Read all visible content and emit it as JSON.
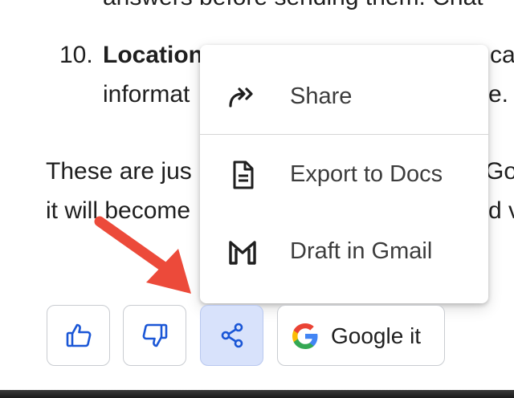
{
  "document": {
    "cut_line": "answers before sending them. Chat",
    "list_number": "10.",
    "list_heading": "Location",
    "list_heading_tail": "ca",
    "list_line2": "informat",
    "list_line2_tail": "e.",
    "para_line1": "These are jus",
    "para_line1_tail": "Go",
    "para_line2": "it will become",
    "para_line2_tail": "d v"
  },
  "share_menu": {
    "items": [
      {
        "label": "Share",
        "icon": "share-forward-icon"
      },
      {
        "label": "Export to Docs",
        "icon": "docs-icon"
      },
      {
        "label": "Draft in Gmail",
        "icon": "gmail-icon"
      }
    ]
  },
  "actions": {
    "like_icon": "thumbs-up-icon",
    "dislike_icon": "thumbs-down-icon",
    "share_icon": "share-icon",
    "google_label": "Google it",
    "google_icon": "google-g-icon"
  },
  "colors": {
    "accent_blue": "#1a56d6",
    "share_active_bg": "#d8e2fb",
    "callout_arrow": "#ec4a3a"
  }
}
